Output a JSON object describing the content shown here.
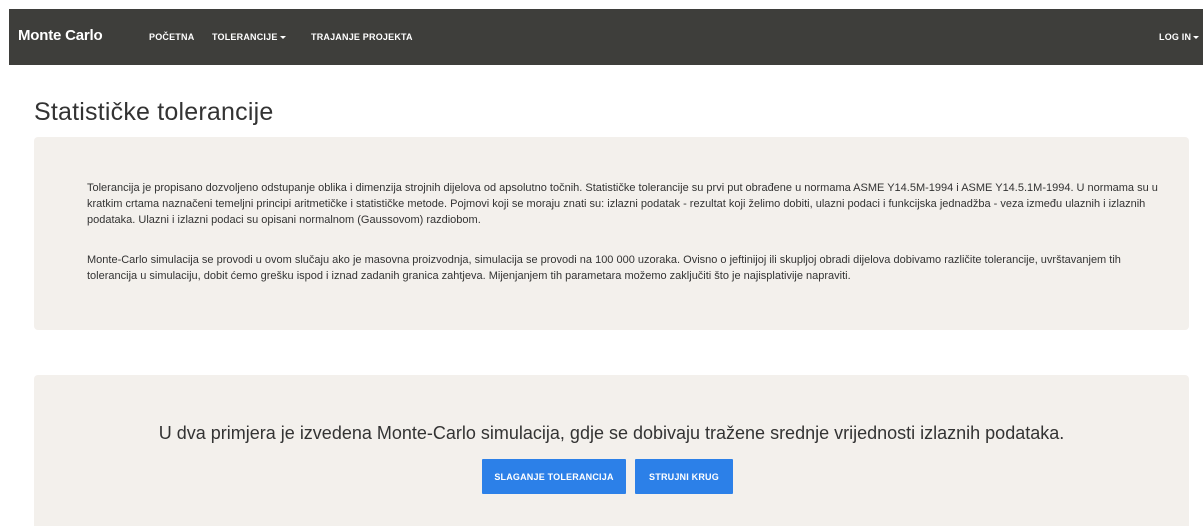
{
  "navbar": {
    "brand": "Monte Carlo",
    "items": [
      {
        "label": "POČETNA"
      },
      {
        "label": "TOLERANCIJE"
      },
      {
        "label": "TRAJANJE PROJEKTA"
      }
    ],
    "login_label": "LOG IN",
    "background_color": "#3e3e3b"
  },
  "main": {
    "title": "Statističke tolerancije",
    "intro_paragraphs": [
      "Tolerancija je propisano dozvoljeno odstupanje oblika i dimenzija strojnih dijelova od apsolutno točnih. Statističke tolerancije su prvi put obrađene u normama ASME Y14.5M-1994 i ASME Y14.5.1M-1994. U normama su u kratkim crtama naznačeni temeljni principi aritmetičke i statističke metode. Pojmovi koji se moraju znati su: izlazni podatak - rezultat koji želimo dobiti, ulazni podaci i funkcijska jednadžba - veza između ulaznih i izlaznih podataka. Ulazni i izlazni podaci su opisani normalnom (Gaussovom) razdiobom.",
      "Monte-Carlo simulacija se provodi u ovom slučaju ako je masovna proizvodnja, simulacija se provodi na 100 000 uzoraka. Ovisno o jeftinijoj ili skupljoj obradi dijelova dobivamo različite tolerancije, uvrštavanjem tih tolerancija u simulaciju, dobit ćemo grešku ispod i iznad zadanih granica zahtjeva. Mijenjanjem tih parametara možemo zaključiti što je najisplativije napraviti."
    ],
    "simulation": {
      "text": "U dva primjera je izvedena Monte-Carlo simulacija, gdje se dobivaju tražene srednje vrijednosti izlaznih podataka.",
      "buttons": [
        {
          "label": "SLAGANJE TOLERANCIJA"
        },
        {
          "label": "STRUJNI KRUG"
        }
      ],
      "button_color": "#2c80e8"
    },
    "panel_color": "#f3f0ec"
  }
}
